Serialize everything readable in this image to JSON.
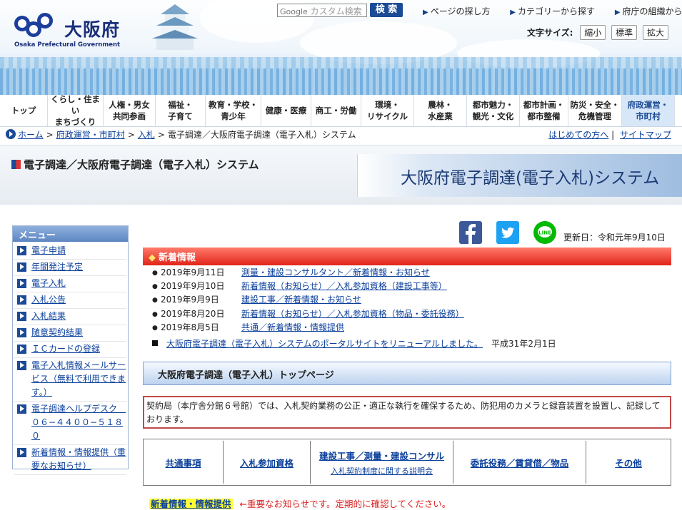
{
  "header": {
    "logo_name": "大阪府",
    "logo_en": "Osaka Prefectural Government",
    "search_brand": "Google",
    "search_placeholder": "カスタム検索",
    "search_button": "検 索",
    "top_links": [
      "ページの探し方",
      "カテゴリーから探す",
      "府庁の組織から探す"
    ],
    "font_size_label": "文字サイズ:",
    "font_size_buttons": [
      "縮小",
      "標準",
      "拡大"
    ]
  },
  "gnav": [
    {
      "label": "トップ"
    },
    {
      "label": "くらし・住まい\nまちづくり"
    },
    {
      "label": "人権・男女\n共同参画"
    },
    {
      "label": "福祉・\n子育て"
    },
    {
      "label": "教育・学校・\n青少年"
    },
    {
      "label": "健康・医療"
    },
    {
      "label": "商工・労働"
    },
    {
      "label": "環境・\nリサイクル"
    },
    {
      "label": "農林・\n水産業"
    },
    {
      "label": "都市魅力・\n観光・文化"
    },
    {
      "label": "都市計画・\n都市整備"
    },
    {
      "label": "防災・安全・\n危機管理"
    },
    {
      "label": "府政運営・\n市町村"
    }
  ],
  "breadcrumb": {
    "items": [
      "ホーム",
      "府政運営・市町村",
      "入札"
    ],
    "current": "電子調達／大阪府電子調達（電子入札）システム",
    "right_links": [
      "はじめての方へ",
      "サイトマップ"
    ],
    "right_sep": "|"
  },
  "page": {
    "title": "電子調達／大阪府電子調達（電子入札）システム",
    "banner": "大阪府電子調達(電子入札)システム",
    "updated": "更新日：令和元年9月10日"
  },
  "menu": {
    "title": "メニュー",
    "items": [
      "電子申請",
      "年間発注予定",
      "電子入札",
      "入札公告",
      "入札結果",
      "随意契約結果",
      "ＩＣカードの登録",
      "電子入札情報メールサービス（無料で利用できます。）",
      "電子調達ヘルプデスク　０６−４４００−５１８０",
      "新着情報・情報提供（重要なお知らせ）"
    ]
  },
  "news": {
    "title": "新着情報",
    "items": [
      {
        "date": "2019年9月11日",
        "text": "測量・建設コンサルタント／新着情報・お知らせ"
      },
      {
        "date": "2019年9月10日",
        "text": "新着情報（お知らせ）／入札参加資格（建設工事等）"
      },
      {
        "date": "2019年9月9日",
        "text": "建設工事／新着情報・お知らせ"
      },
      {
        "date": "2019年8月20日",
        "text": "新着情報（お知らせ）／入札参加資格（物品・委託役務）"
      },
      {
        "date": "2019年8月5日",
        "text": "共通／新着情報・情報提供"
      }
    ],
    "notice_link": "大阪府電子調達（電子入札）システムのポータルサイトをリニューアルしました。",
    "notice_date": "平成31年2月1日"
  },
  "top_page_label": "大阪府電子調達（電子入札）トップページ",
  "alert_text": "契約局（本庁舎分館６号館）では、入札契約業務の公正・適正な執行を確保するため、防犯用のカメラと録音装置を設置し、記録しております。",
  "categories": [
    {
      "label": "共通事項",
      "sub": ""
    },
    {
      "label": "入札参加資格",
      "sub": ""
    },
    {
      "label": "建設工事／測量・建設コンサル",
      "sub": "入札契約制度に関する説明会"
    },
    {
      "label": "委託役務／賃貸借／物品",
      "sub": ""
    },
    {
      "label": "その他",
      "sub": ""
    }
  ],
  "bottom": {
    "highlight": "新着情報・情報提供",
    "warning": "←重要なお知らせです。定期的に確認してください。"
  },
  "colors": {
    "brand": "#1b4a96",
    "news_bar": "#e2251a",
    "alert_border": "#c04a4a",
    "highlight": "#ffff33"
  }
}
